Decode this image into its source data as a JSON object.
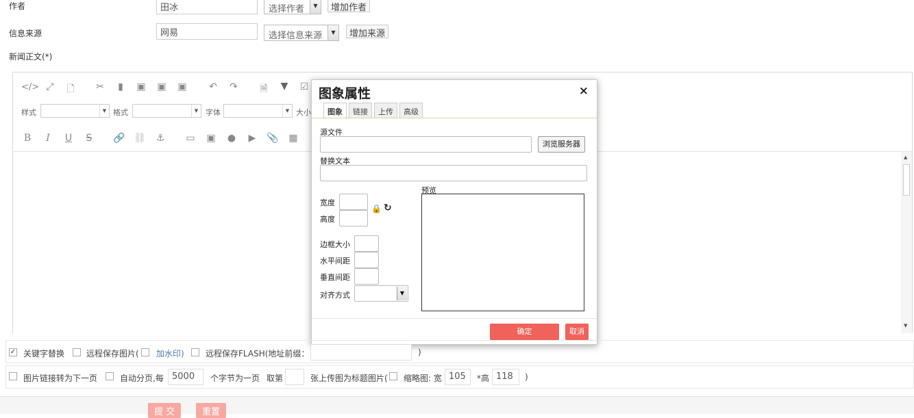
{
  "form": {
    "author_label": "作者",
    "author_value": "田冰",
    "author_select": "选择作者",
    "add_author": "增加作者",
    "source_label": "信息来源",
    "source_value": "网易",
    "source_select": "选择信息来源",
    "add_source": "增加来源",
    "body_label": "新闻正文(*)"
  },
  "editor": {
    "style_label": "样式",
    "format_label": "格式",
    "font_label": "字体",
    "size_label": "大小",
    "bold": "B",
    "italic": "I",
    "underline": "U",
    "strike": "S",
    "source_icon": "</>",
    "icons": [
      "code-icon",
      "maximize-icon",
      "preview-icon",
      "cut-icon",
      "copy-icon",
      "paste-icon",
      "paste-text-icon",
      "paste-word-icon",
      "undo-icon",
      "redo-icon",
      "find-icon",
      "filter-icon",
      "checkbox-icon",
      "link-icon",
      "unlink-icon",
      "anchor-icon",
      "image-icon",
      "image2-icon",
      "flash-icon",
      "media-icon",
      "attach-icon",
      "table-icon"
    ]
  },
  "dialog": {
    "title": "图象属性",
    "close": "×",
    "tabs": [
      "图象",
      "链接",
      "上传",
      "高级"
    ],
    "source_file": "源文件",
    "browse": "浏览服务器",
    "alt_text": "替换文本",
    "width": "宽度",
    "height": "高度",
    "preview": "预览",
    "border": "边框大小",
    "hspace": "水平间距",
    "vspace": "垂直间距",
    "align": "对齐方式",
    "ok": "确定",
    "cancel": "取消"
  },
  "options": {
    "keyword_replace": "关键字替换",
    "remote_save_image": "远程保存图片(",
    "watermark": "加水印)",
    "remote_save_flash": "远程保存FLASH(地址前缀：",
    "close_paren": ")",
    "img_link_next": "图片链接转为下一页",
    "auto_page": "自动分页,每",
    "page_chars": "5000",
    "chars_per_page": "个字节为一页",
    "take_nth": "取第",
    "nth_value": "",
    "title_img_text": "张上传图为标题图片(",
    "thumbnail": "缩略图: 宽",
    "thumb_width": "105",
    "height_label": "*高",
    "thumb_height": "118",
    "end_paren": ")"
  },
  "actions": {
    "submit": "提 交",
    "reset": "重置"
  }
}
